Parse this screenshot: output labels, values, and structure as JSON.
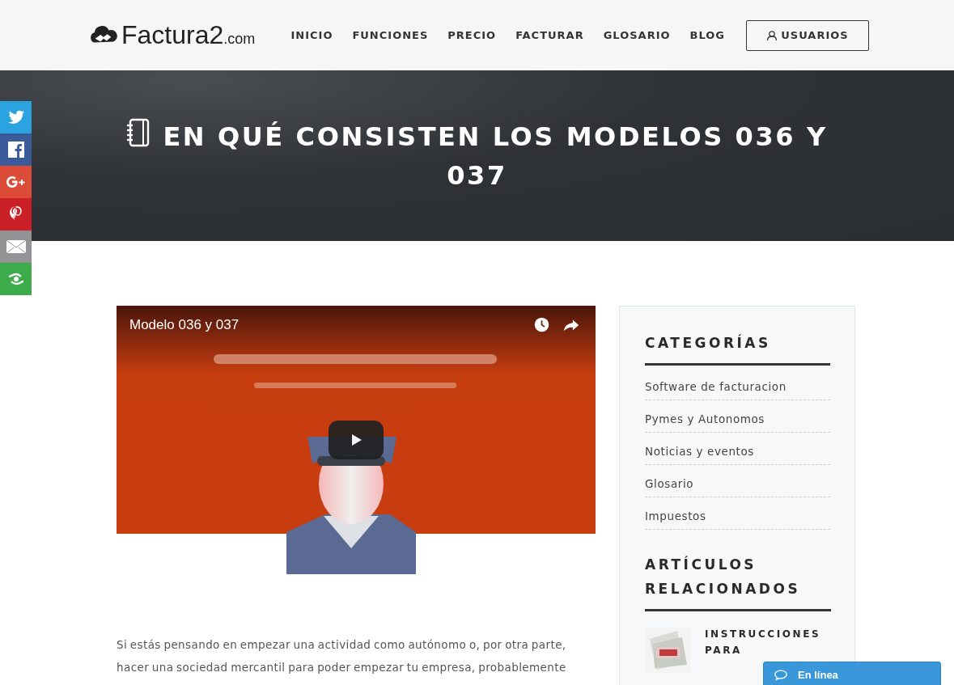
{
  "header": {
    "logo": {
      "name": "Factura2",
      "suffix": ".com"
    },
    "nav": [
      {
        "label": "INICIO"
      },
      {
        "label": "FUNCIONES"
      },
      {
        "label": "PRECIO"
      },
      {
        "label": "FACTURAR"
      },
      {
        "label": "GLOSARIO"
      },
      {
        "label": "BLOG"
      }
    ],
    "users_button": "USUARIOS"
  },
  "share_bar": [
    {
      "kind": "twitter",
      "color": "#2aa3e0"
    },
    {
      "kind": "facebook",
      "color": "#3b5a9a"
    },
    {
      "kind": "googleplus",
      "color": "#dd4b39"
    },
    {
      "kind": "pinterest",
      "color": "#cb2027"
    },
    {
      "kind": "email",
      "color": "#939396"
    },
    {
      "kind": "more",
      "color": "#3cab49"
    }
  ],
  "hero": {
    "title": "EN QUÉ CONSISTEN LOS MODELOS 036 Y 037"
  },
  "video": {
    "kind": "picture",
    "title": "Modelo 036 y 037"
  },
  "article": {
    "paragraph": "Si estás pensando en empezar una actividad como autónomo o, por otra parte,\nhacer una sociedad mercantil para poder empezar tu empresa, probablemente"
  },
  "sidebar": {
    "categories": {
      "title": "CATEGORÍAS",
      "items": [
        {
          "label": "Software de facturacion"
        },
        {
          "label": "Pymes y Autonomos"
        },
        {
          "label": "Noticias y eventos"
        },
        {
          "label": "Glosario"
        },
        {
          "label": "Impuestos"
        }
      ]
    },
    "related": {
      "title": "ARTÍCULOS RELACIONADOS",
      "items": [
        {
          "title": "INSTRUCCIONES PARA"
        }
      ]
    }
  },
  "chat": {
    "label": "En línea"
  }
}
